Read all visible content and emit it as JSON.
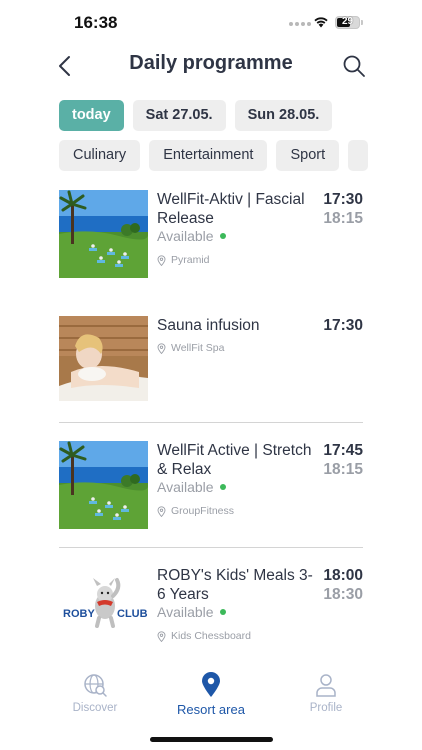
{
  "status_bar": {
    "time": "16:38",
    "battery": "29"
  },
  "header": {
    "title": "Daily programme",
    "back_icon": "chevron-left-icon",
    "search_icon": "search-icon"
  },
  "date_filters": [
    "today",
    "Sat 27.05.",
    "Sun 28.05."
  ],
  "active_date": "today",
  "category_filters": [
    "Culinary",
    "Entertainment",
    "Sport"
  ],
  "events": [
    {
      "title": "WellFit-Aktiv | Fascial Release",
      "start": "17:30",
      "end": "18:15",
      "availability": "Available",
      "location": "Pyramid",
      "image": "yoga-lawn-sea"
    },
    {
      "title": "Sauna infusion",
      "start": "17:30",
      "end": "",
      "availability": "",
      "location": "WellFit Spa",
      "image": "spa-woman"
    },
    {
      "title": "WellFit Active | Stretch & Relax",
      "start": "17:45",
      "end": "18:15",
      "availability": "Available",
      "location": "GroupFitness",
      "image": "yoga-lawn-sea"
    },
    {
      "title": "ROBY's Kids' Meals 3-6 Years",
      "start": "18:00",
      "end": "18:30",
      "availability": "Available",
      "location": "Kids Chessboard",
      "image": "roby-club-logo",
      "logo_text": {
        "left": "ROBY",
        "right": "CLUB"
      }
    }
  ],
  "tabbar": {
    "items": [
      {
        "label": "Discover",
        "icon": "globe-search-icon"
      },
      {
        "label": "Resort area",
        "icon": "location-pin-icon"
      },
      {
        "label": "Profile",
        "icon": "person-icon"
      }
    ],
    "active": "Resort area"
  },
  "colors": {
    "accent": "#5ab0a6",
    "active_tab": "#1e57a8",
    "available_dot": "#3cb95a"
  }
}
